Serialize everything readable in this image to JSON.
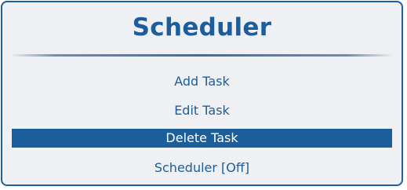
{
  "dialog": {
    "title": "Scheduler",
    "menu": {
      "items": [
        {
          "label": "Add Task",
          "selected": false
        },
        {
          "label": "Edit Task",
          "selected": false
        },
        {
          "label": "Delete Task",
          "selected": true
        },
        {
          "label": "Scheduler [Off]",
          "selected": false
        }
      ]
    }
  },
  "colors": {
    "accent": "#1a5f9c",
    "panel_background": "#eef0f3",
    "text": "#1e5d9a",
    "selected_text": "#ffffff"
  }
}
